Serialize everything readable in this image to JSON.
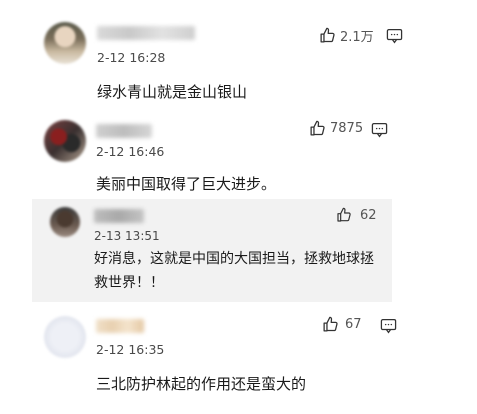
{
  "comments": [
    {
      "time": "2-12 16:28",
      "likes": "2.1万",
      "text": "绿水青山就是金山银山"
    },
    {
      "time": "2-12 16:46",
      "likes": "7875",
      "text": "美丽中国取得了巨大进步。"
    },
    {
      "time": "2-13 13:51",
      "likes": "62",
      "text_line1": "好消息，这就是中国的大国担当，拯救地球拯",
      "text_line2": "救世界！！"
    },
    {
      "time": "2-12 16:35",
      "likes": "67",
      "text": "三北防护林起的作用还是蛮大的"
    }
  ],
  "icons": {
    "like": "thumbs-up-icon",
    "reply": "comment-reply-icon"
  },
  "colors": {
    "nested_background": "#f2f2f2",
    "text": "#1a1a1a",
    "meta": "#4a4a4a"
  }
}
